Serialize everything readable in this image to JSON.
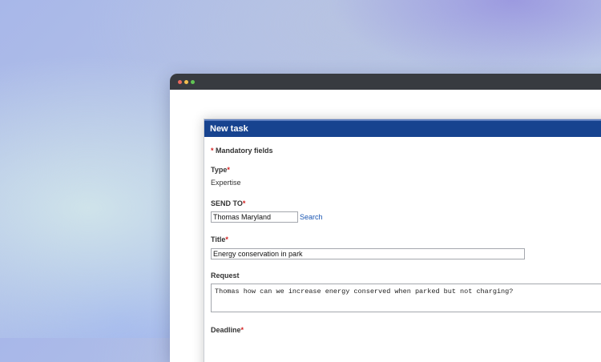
{
  "form": {
    "title": "New task",
    "mandatory_star": "*",
    "mandatory_note": "Mandatory fields",
    "fields": {
      "type": {
        "label": "Type",
        "value": "Expertise"
      },
      "send_to": {
        "label": "SEND TO",
        "value": "Thomas Maryland",
        "action": "Search"
      },
      "title": {
        "label": "Title",
        "value": "Energy conservation in park"
      },
      "request": {
        "label": "Request",
        "value": "Thomas how can we increase energy conserved when parked but not charging?"
      },
      "deadline": {
        "label": "Deadline"
      }
    }
  },
  "colors": {
    "header_bg": "#17438f",
    "required_star": "#d21e1e",
    "link": "#1a56b3",
    "titlebar": "#383b40"
  }
}
